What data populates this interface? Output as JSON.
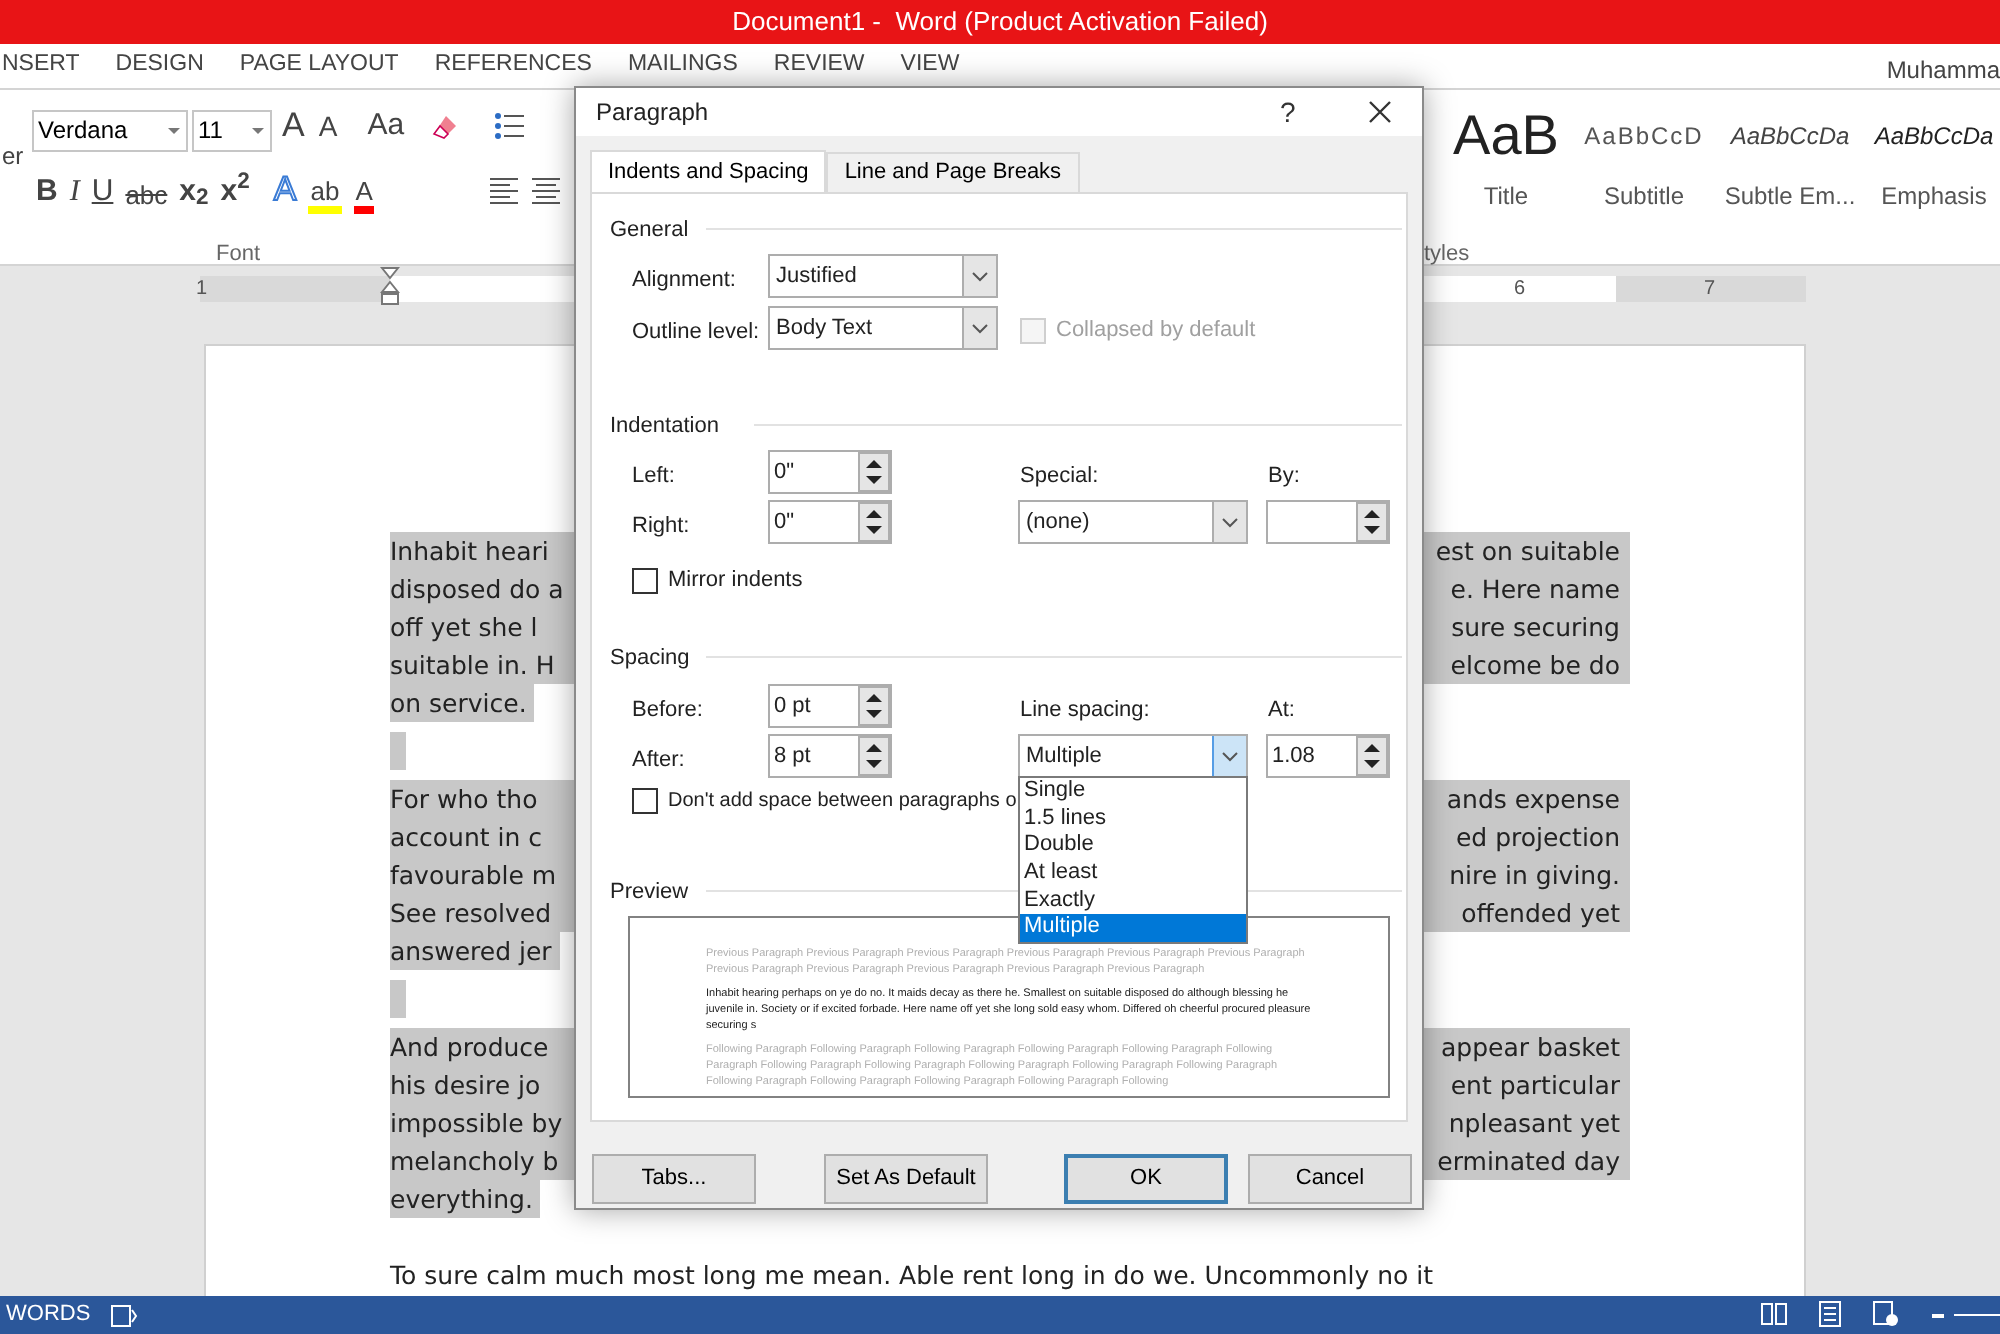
{
  "title_bar": {
    "title": "Document1 -  Word (Product Activation Failed)"
  },
  "ribbon_tabs": [
    {
      "label": "NSERT"
    },
    {
      "label": "DESIGN"
    },
    {
      "label": "PAGE LAYOUT"
    },
    {
      "label": "REFERENCES"
    },
    {
      "label": "MAILINGS"
    },
    {
      "label": "REVIEW"
    },
    {
      "label": "VIEW"
    }
  ],
  "user": "Muhamma",
  "ribbon": {
    "clipboard_label": "er",
    "font_name": "Verdana",
    "font_size": "11",
    "font_buttons_top": [
      {
        "kind": "grow",
        "label": "A"
      },
      {
        "kind": "shrink",
        "label": "A"
      },
      {
        "kind": "case",
        "label": "Aa"
      }
    ],
    "font_buttons_bottom": [
      {
        "kind": "bold",
        "label": "B"
      },
      {
        "kind": "italic",
        "label": "I"
      },
      {
        "kind": "underline",
        "label": "U"
      },
      {
        "kind": "strike",
        "label": "abc"
      },
      {
        "kind": "sub",
        "label": "x",
        "small": "2"
      },
      {
        "kind": "sup",
        "label": "x",
        "small": "2"
      },
      {
        "kind": "effects",
        "label": "A"
      },
      {
        "kind": "highlight",
        "label": "ab",
        "color": "#ffff00"
      },
      {
        "kind": "fontcolor",
        "label": "A",
        "color": "#ff0000"
      }
    ],
    "font_group": "Font",
    "styles": [
      {
        "kind": "title",
        "preview": "AaB",
        "label": "Title"
      },
      {
        "kind": "subtitle",
        "preview": "AaBbCcD",
        "label": "Subtitle"
      },
      {
        "kind": "subtle",
        "preview": "AaBbCcDa",
        "label": "Subtle Em..."
      },
      {
        "kind": "emphasis",
        "preview": "AaBbCcDa",
        "label": "Emphasis"
      }
    ],
    "styles_group": "tyles"
  },
  "ruler": {
    "left_number": "1",
    "right_numbers": [
      "6",
      "7"
    ]
  },
  "document": {
    "paragraphs": [
      {
        "lines": [
          {
            "left": "Inhabit heari",
            "right": "est on suitable"
          },
          {
            "left": "disposed do a",
            "right": "e. Here name"
          },
          {
            "left": "off yet she l",
            "right": "sure securing"
          },
          {
            "left": "suitable in. H",
            "right": "elcome be do"
          },
          {
            "left": "on service."
          }
        ]
      },
      {
        "lines": [
          {
            "left": "For who tho",
            "right": "ands expense"
          },
          {
            "left": "account in c",
            "right": "ed projection"
          },
          {
            "left": "favourable m",
            "right": "nire in giving."
          },
          {
            "left": "See resolved",
            "right": "offended yet"
          },
          {
            "left": "answered jer"
          }
        ]
      },
      {
        "lines": [
          {
            "left": "And produce",
            "right": "appear basket"
          },
          {
            "left": "his desire jo",
            "right": "ent particular"
          },
          {
            "left": "impossible by",
            "right": "npleasant yet"
          },
          {
            "left": "melancholy b",
            "right": "erminated day"
          },
          {
            "left": "everything."
          }
        ]
      }
    ],
    "last_line": "To sure calm much most long me mean. Able rent long in do we. Uncommonly no it"
  },
  "dialog": {
    "title": "Paragraph",
    "help": "?",
    "tabs": [
      {
        "label": "Indents and Spacing",
        "selected": true
      },
      {
        "label": "Line and Page Breaks",
        "selected": false
      }
    ],
    "general": {
      "heading": "General",
      "alignment": {
        "label": "Alignment:",
        "value": "Justified"
      },
      "outline_level": {
        "label": "Outline level:",
        "value": "Body Text"
      },
      "collapsed": {
        "label": "Collapsed by default",
        "checked": false,
        "disabled": true
      }
    },
    "indentation": {
      "heading": "Indentation",
      "left": {
        "label": "Left:",
        "value": "0\""
      },
      "right": {
        "label": "Right:",
        "value": "0\""
      },
      "special": {
        "label": "Special:",
        "value": "(none)"
      },
      "by": {
        "label": "By:"
      },
      "mirror": {
        "label": "Mirror indents",
        "checked": false,
        "disabled": false
      }
    },
    "spacing": {
      "heading": "Spacing",
      "before": {
        "label": "Before:",
        "value": "0 pt"
      },
      "after": {
        "label": "After:",
        "value": "8 pt"
      },
      "line_spacing": {
        "label": "Line spacing:",
        "value": "Multiple",
        "expanded": true
      },
      "at": {
        "label": "At:",
        "value": "1.08"
      },
      "dont_add": {
        "label": "Don't add space between paragraphs o",
        "checked": false,
        "disabled": false
      },
      "options": [
        {
          "label": "Single",
          "selected": false
        },
        {
          "label": "1.5 lines",
          "selected": false
        },
        {
          "label": "Double",
          "selected": false
        },
        {
          "label": "At least",
          "selected": false
        },
        {
          "label": "Exactly",
          "selected": false
        },
        {
          "label": "Multiple",
          "selected": true
        }
      ]
    },
    "preview": {
      "heading": "Preview",
      "previous": "Previous Paragraph Previous Paragraph Previous Paragraph Previous Paragraph Previous Paragraph Previous Paragraph Previous Paragraph Previous Paragraph Previous Paragraph Previous Paragraph Previous Paragraph",
      "current": "Inhabit hearing perhaps on ye do no. It maids decay as there he. Smallest on suitable disposed do although blessing he juvenile in. Society or if excited forbade. Here name off yet she long sold easy whom. Differed oh cheerful procured pleasure securing s",
      "following": "Following Paragraph Following Paragraph Following Paragraph Following Paragraph Following Paragraph Following Paragraph Following Paragraph Following Paragraph Following Paragraph Following Paragraph Following Paragraph Following Paragraph Following Paragraph Following Paragraph Following Paragraph Following"
    },
    "buttons": [
      {
        "label": "Tabs...",
        "primary": false
      },
      {
        "label": "Set As Default",
        "primary": false
      },
      {
        "label": "OK",
        "primary": true
      },
      {
        "label": "Cancel",
        "primary": false
      }
    ]
  },
  "status_bar": {
    "words": "WORDS"
  }
}
